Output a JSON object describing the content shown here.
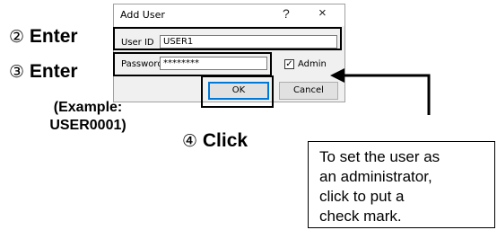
{
  "dialog": {
    "title": "Add User",
    "help_glyph": "?",
    "close_glyph": "×",
    "user_id_label": "User ID",
    "user_id_value": "USER1",
    "password_label": "Password",
    "password_value": "********",
    "admin_label": "Admin",
    "admin_checked": true,
    "check_glyph": "✓",
    "ok_label": "OK",
    "cancel_label": "Cancel"
  },
  "annotations": {
    "step2": {
      "num": "②",
      "text": "Enter"
    },
    "step3": {
      "num": "③",
      "text": "Enter"
    },
    "example_line1": "(Example:",
    "example_line2": "USER0001)",
    "step4": {
      "num": "④",
      "text": "Click"
    },
    "callout_lines": [
      "To set the user as",
      "an administrator,",
      "click to put a",
      "check mark."
    ]
  }
}
